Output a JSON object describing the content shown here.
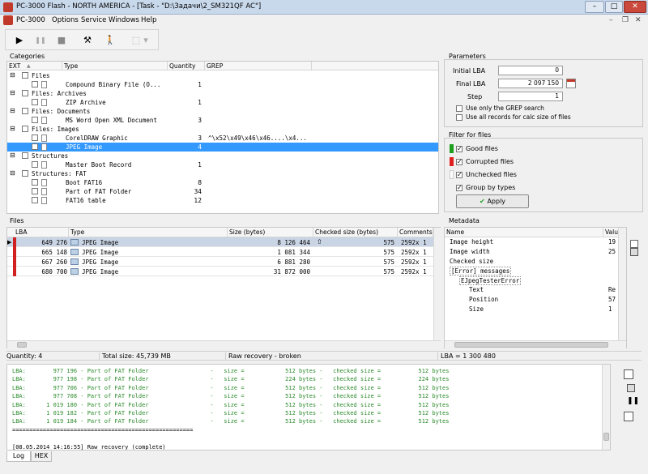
{
  "window": {
    "title": "PC-3000 Flash  -  NORTH AMERICA  -  [Task - \"D:\\Задачи\\2_SM321QF AC\"]",
    "minimize": "–",
    "maximize": "□",
    "close": "✕"
  },
  "menu": {
    "items": [
      {
        "label": "PC-3000"
      },
      {
        "label": "Options"
      },
      {
        "label": "Service"
      },
      {
        "label": "Windows"
      },
      {
        "label": "Help"
      }
    ],
    "mdi_minimize": "–",
    "mdi_restore": "❐",
    "mdi_close": "✕"
  },
  "toolbar": {
    "play": "▶",
    "pause": "❚❚",
    "stop": "■",
    "tools": "⚒",
    "exit": "🚶",
    "disabled": "⬚",
    "dropdown": "▾"
  },
  "categories": {
    "title": "Categories",
    "columns": {
      "ext": "EXT",
      "sort": "▲",
      "type": "Type",
      "quantity": "Quantity",
      "grep": "GREP"
    },
    "rows": [
      {
        "kind": "group",
        "label": "Files",
        "expander": "⊟"
      },
      {
        "kind": "item",
        "type": "Compound Binary File (O...",
        "quantity": "1",
        "grep": "",
        "selected": false
      },
      {
        "kind": "group",
        "label": "Files: Archives",
        "expander": "⊟"
      },
      {
        "kind": "item",
        "type": "ZIP Archive",
        "quantity": "1",
        "grep": "",
        "selected": false
      },
      {
        "kind": "group",
        "label": "Files: Documents",
        "expander": "⊟"
      },
      {
        "kind": "item",
        "type": "MS Word Open XML Document",
        "quantity": "3",
        "grep": "",
        "selected": false
      },
      {
        "kind": "group",
        "label": "Files: Images",
        "expander": "⊟"
      },
      {
        "kind": "item",
        "type": "CorelDRAW Graphic",
        "quantity": "3",
        "grep": "^\\x52\\x49\\x46\\x46....\\x4...",
        "selected": false
      },
      {
        "kind": "item",
        "type": "JPEG Image",
        "quantity": "4",
        "grep": "",
        "selected": true
      },
      {
        "kind": "group",
        "label": "Structures",
        "expander": "⊟"
      },
      {
        "kind": "item",
        "type": "Master Boot Record",
        "quantity": "1",
        "grep": "",
        "selected": false
      },
      {
        "kind": "group",
        "label": "Structures: FAT",
        "expander": "⊟"
      },
      {
        "kind": "item",
        "type": "Boot FAT16",
        "quantity": "8",
        "grep": "",
        "selected": false
      },
      {
        "kind": "item",
        "type": "Part of FAT Folder",
        "quantity": "34",
        "grep": "",
        "selected": false
      },
      {
        "kind": "item",
        "type": "FAT16 table",
        "quantity": "12",
        "grep": "",
        "selected": false
      }
    ]
  },
  "parameters": {
    "title": "Parameters",
    "initial_lba_label": "Initial LBA",
    "initial_lba_value": "0",
    "final_lba_label": "Final LBA",
    "final_lba_value": "2 097 150",
    "step_label": "Step",
    "step_value": "1",
    "grep_only_label": "Use only the GREP search",
    "all_records_label": "Use all records for calc size of files"
  },
  "filter": {
    "title": "Filter for files",
    "good_label": "Good files",
    "corrupted_label": "Corrupted files",
    "unchecked_label": "Unchecked files",
    "group_label": "Group by types",
    "apply_label": "Apply",
    "good_color": "#1e9e1e",
    "corrupted_color": "#e02020",
    "unchecked_color": "#ffffff"
  },
  "files": {
    "title": "Files",
    "columns": {
      "lba": "LBA",
      "type": "Type",
      "size": "Size (bytes)",
      "checked": "Checked size (bytes)",
      "comments": "Comments"
    },
    "rows": [
      {
        "lba": "649 276",
        "type": "JPEG Image",
        "size": "8 126 464",
        "checked": "575",
        "comments": "2592x 1",
        "selected": true
      },
      {
        "lba": "665 148",
        "type": "JPEG Image",
        "size": "1 081 344",
        "checked": "575",
        "comments": "2592x 1",
        "selected": false
      },
      {
        "lba": "667 260",
        "type": "JPEG Image",
        "size": "6 881 280",
        "checked": "575",
        "comments": "2592x 1",
        "selected": false
      },
      {
        "lba": "680 700",
        "type": "JPEG Image",
        "size": "31 872 000",
        "checked": "575",
        "comments": "2592x 1",
        "selected": false
      }
    ],
    "status_color": "#d02020"
  },
  "metadata": {
    "title": "Metadata",
    "columns": {
      "name": "Name",
      "value": "Value"
    },
    "rows": [
      {
        "name": "Image height",
        "value": "19",
        "indent": 0
      },
      {
        "name": "Image width",
        "value": "25",
        "indent": 0
      },
      {
        "name": "Checked size",
        "value": "",
        "indent": 0
      },
      {
        "name": "[Error] messages",
        "value": "",
        "indent": 0
      },
      {
        "name": "EJpegTesterError",
        "value": "",
        "indent": 1
      },
      {
        "name": "Text",
        "value": "Re",
        "indent": 2
      },
      {
        "name": "Position",
        "value": "57",
        "indent": 2
      },
      {
        "name": "Size",
        "value": "1",
        "indent": 2
      }
    ]
  },
  "status": {
    "quantity": "Quantity: 4",
    "total_size": "Total size: 45,739 MB",
    "mode": "Raw recovery - broken",
    "lba": "LBA =    1 300 480"
  },
  "log": {
    "lines": [
      {
        "text": "LBA:        977 196 - Part of FAT Folder                  -   size =            512 bytes -   checked size =           512 bytes",
        "kind": "green"
      },
      {
        "text": "LBA:        977 198 - Part of FAT Folder                  -   size =            224 bytes -   checked size =           224 bytes",
        "kind": "green"
      },
      {
        "text": "LBA:        977 706 - Part of FAT Folder                  -   size =            512 bytes -   checked size =           512 bytes",
        "kind": "green"
      },
      {
        "text": "LBA:        977 708 - Part of FAT Folder                  -   size =            512 bytes -   checked size =           512 bytes",
        "kind": "green"
      },
      {
        "text": "LBA:      1 019 180 - Part of FAT Folder                  -   size =            512 bytes -   checked size =           512 bytes",
        "kind": "green"
      },
      {
        "text": "LBA:      1 019 182 - Part of FAT Folder                  -   size =            512 bytes -   checked size =           512 bytes",
        "kind": "green"
      },
      {
        "text": "LBA:      1 019 184 - Part of FAT Folder                  -   size =            512 bytes -   checked size =           512 bytes",
        "kind": "green"
      },
      {
        "text": "=====================================================",
        "kind": "k"
      },
      {
        "text": "",
        "kind": "k"
      },
      {
        "text": "[08.05.2014 14:16:55] Raw recovery (complete)",
        "kind": "k"
      },
      {
        "text": "=====================================================",
        "kind": "k"
      }
    ],
    "tabs": [
      {
        "label": "Log"
      },
      {
        "label": "HEX"
      }
    ]
  }
}
